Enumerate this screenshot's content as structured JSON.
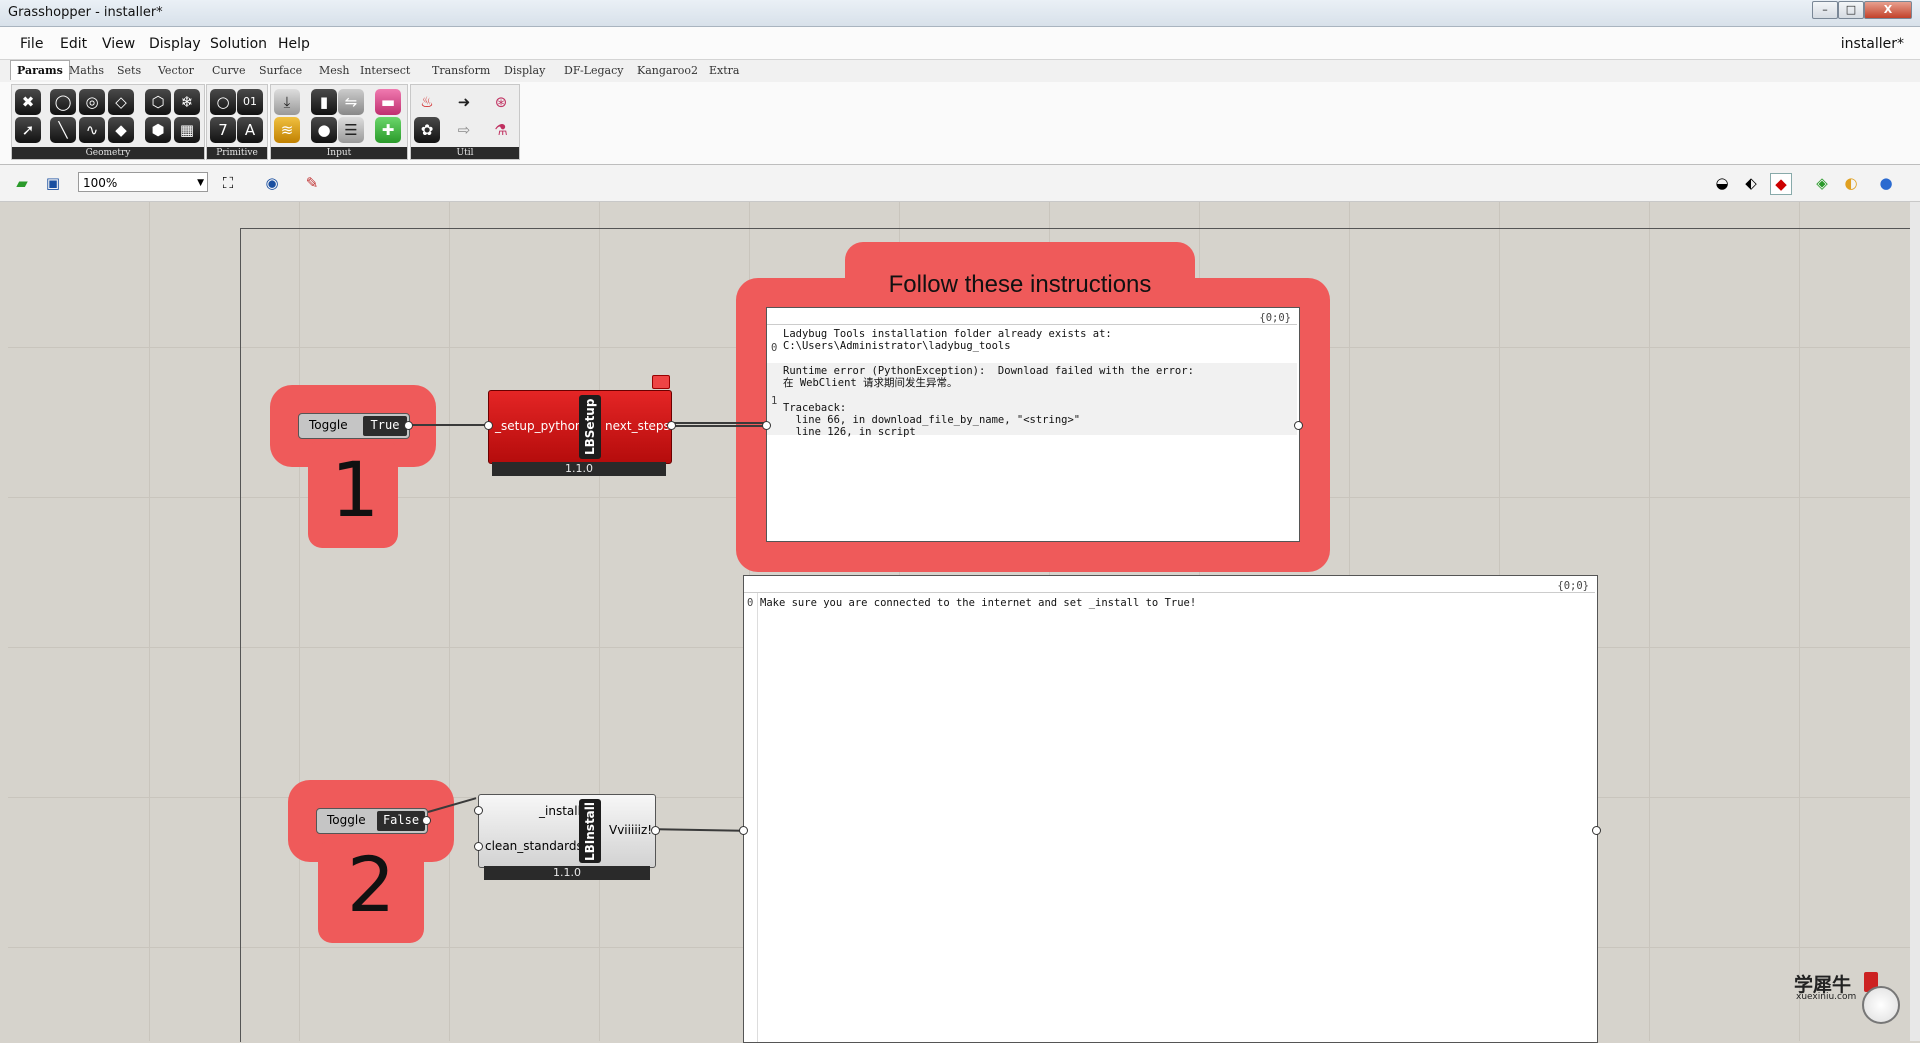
{
  "window": {
    "title": "Grasshopper - installer*",
    "doc_name": "installer*",
    "btn_min": "–",
    "btn_max": "□",
    "btn_close": "X"
  },
  "menu": [
    "File",
    "Edit",
    "View",
    "Display",
    "Solution",
    "Help"
  ],
  "tabs": [
    "Params",
    "Maths",
    "Sets",
    "Vector",
    "Curve",
    "Surface",
    "Mesh",
    "Intersect",
    "Transform",
    "Display",
    "DF-Legacy",
    "Kangaroo2",
    "Extra"
  ],
  "active_tab": "Params",
  "ribbon_panels": [
    "Geometry",
    "Primitive",
    "Input",
    "Util"
  ],
  "primitive_icons": [
    "01",
    "7",
    "A"
  ],
  "toolbar": {
    "zoom": "100%"
  },
  "groups": {
    "one_label": "1",
    "two_label": "2",
    "instructions_title": "Follow these instructions"
  },
  "toggles": {
    "first": {
      "label": "Toggle",
      "value": "True"
    },
    "second": {
      "label": "Toggle",
      "value": "False"
    }
  },
  "lbsetup": {
    "name": "LBSetup",
    "input": "_setup_python",
    "output": "next_steps",
    "version": "1.1.0"
  },
  "lbinstall": {
    "name": "LBInstall",
    "input1": "_install",
    "input2": "clean_standards_",
    "output": "Vviiiiiz!",
    "version": "1.1.0"
  },
  "panel1": {
    "path": "{0;0}",
    "idx0": "0",
    "idx1": "1",
    "line1": "Ladybug Tools installation folder already exists at:",
    "line2": "C:\\Users\\Administrator\\ladybug_tools",
    "line3": "Runtime error (PythonException):  Download failed with the error:",
    "line4": "在 WebClient 请求期间发生异常。",
    "line5": "Traceback:",
    "line6": "  line 66, in download_file_by_name, \"<string>\"",
    "line7": "  line 126, in script"
  },
  "panel2": {
    "path": "{0;0}",
    "idx0": "0",
    "line1": "Make sure you are connected to the internet and set _install to True!"
  },
  "watermark": {
    "cn": "学犀牛",
    "url": "xuexiniu.com"
  }
}
